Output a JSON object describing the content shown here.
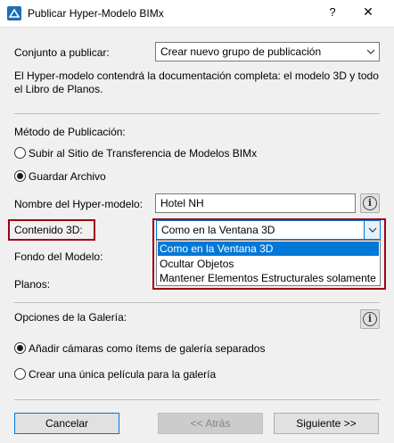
{
  "window": {
    "title": "Publicar Hyper-Modelo BIMx",
    "help_label": "?",
    "close_label": "✕"
  },
  "publish_set": {
    "label": "Conjunto a publicar:",
    "value": "Crear nuevo grupo de publicación"
  },
  "description": "El Hyper-modelo contendrá la documentación completa: el modelo 3D y todo el Libro de Planos.",
  "method": {
    "label": "Método de Publicación:",
    "options": [
      {
        "label": "Subir al Sitio de Transferencia de Modelos BIMx",
        "checked": false
      },
      {
        "label": "Guardar Archivo",
        "checked": true
      }
    ]
  },
  "hypermodel_name": {
    "label": "Nombre del Hyper-modelo:",
    "value": "Hotel NH"
  },
  "content3d": {
    "label": "Contenido 3D:",
    "value": "Como en la Ventana 3D",
    "options": [
      {
        "label": "Como en la Ventana 3D",
        "selected": true
      },
      {
        "label": "Ocultar Objetos",
        "selected": false
      },
      {
        "label": "Mantener Elementos Estructurales solamente",
        "selected": false
      }
    ]
  },
  "model_background": {
    "label": "Fondo del Modelo:"
  },
  "sheets": {
    "label": "Planos:"
  },
  "gallery": {
    "label": "Opciones de la Galería:",
    "options": [
      {
        "label": "Añadir cámaras como ítems de galería separados",
        "checked": true
      },
      {
        "label": "Crear una única película para la galería",
        "checked": false
      }
    ]
  },
  "buttons": {
    "cancel": "Cancelar",
    "back": "<< Atrás",
    "next": "Siguiente >>"
  },
  "colors": {
    "highlight": "#a0000f",
    "selection": "#0078d7"
  }
}
